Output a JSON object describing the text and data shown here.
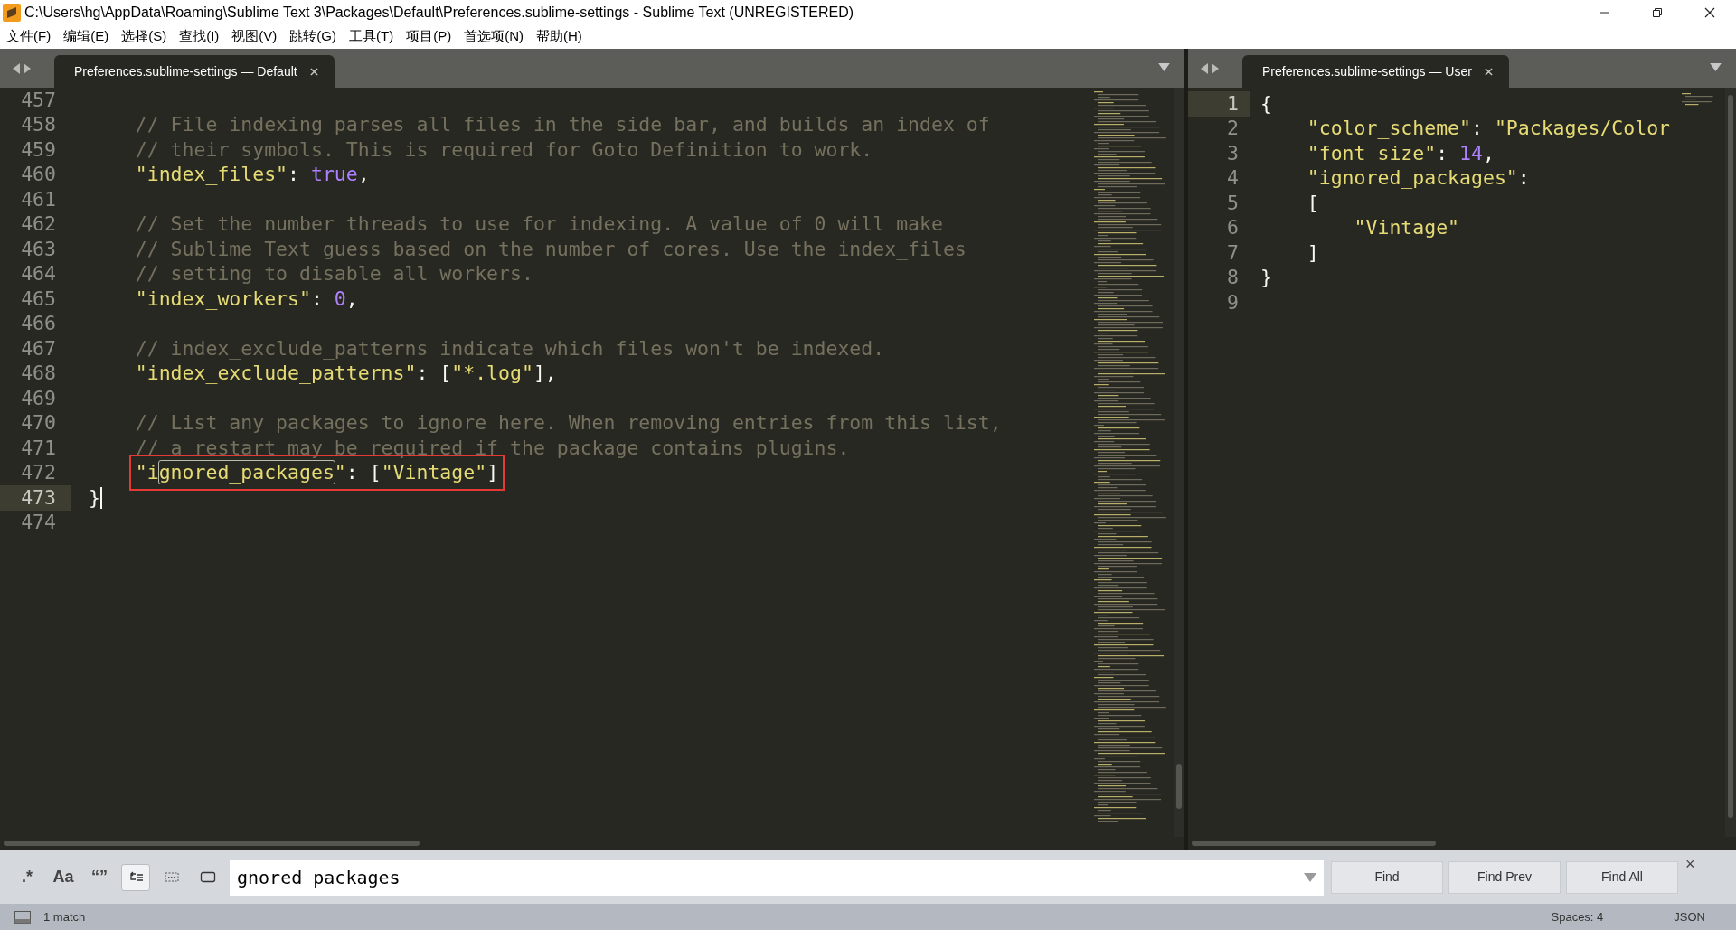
{
  "window": {
    "title": "C:\\Users\\hg\\AppData\\Roaming\\Sublime Text 3\\Packages\\Default\\Preferences.sublime-settings - Sublime Text (UNREGISTERED)"
  },
  "menu": [
    "文件(F)",
    "编辑(E)",
    "选择(S)",
    "查找(I)",
    "视图(V)",
    "跳转(G)",
    "工具(T)",
    "项目(P)",
    "首选项(N)",
    "帮助(H)"
  ],
  "panes": [
    {
      "tabs": [
        {
          "label": "Preferences.sublime-settings — Default",
          "selected": true
        }
      ],
      "lines": [
        {
          "number": "457",
          "current": false
        },
        {
          "number": "458",
          "current": false,
          "segments": [
            {
              "kind": "comment",
              "text": "    // File indexing parses all files in the side bar, and builds an index of"
            }
          ]
        },
        {
          "number": "459",
          "current": false,
          "segments": [
            {
              "kind": "comment",
              "text": "    // their symbols. This is required for Goto Definition to work."
            }
          ]
        },
        {
          "number": "460",
          "current": false,
          "segments": [
            {
              "kind": "string",
              "text": "    \"index_files\""
            },
            {
              "kind": "punct",
              "text": ": "
            },
            {
              "kind": "constant",
              "text": "true"
            },
            {
              "kind": "punct",
              "text": ","
            }
          ]
        },
        {
          "number": "461",
          "current": false
        },
        {
          "number": "462",
          "current": false,
          "segments": [
            {
              "kind": "comment",
              "text": "    // Set the number threads to use for indexing. A value of 0 will make"
            }
          ]
        },
        {
          "number": "463",
          "current": false,
          "segments": [
            {
              "kind": "comment",
              "text": "    // Sublime Text guess based on the number of cores. Use the index_files"
            }
          ]
        },
        {
          "number": "464",
          "current": false,
          "segments": [
            {
              "kind": "comment",
              "text": "    // setting to disable all workers."
            }
          ]
        },
        {
          "number": "465",
          "current": false,
          "segments": [
            {
              "kind": "string",
              "text": "    \"index_workers\""
            },
            {
              "kind": "punct",
              "text": ": "
            },
            {
              "kind": "constant",
              "text": "0"
            },
            {
              "kind": "punct",
              "text": ","
            }
          ]
        },
        {
          "number": "466",
          "current": false
        },
        {
          "number": "467",
          "current": false,
          "segments": [
            {
              "kind": "comment",
              "text": "    // index_exclude_patterns indicate which files won't be indexed."
            }
          ]
        },
        {
          "number": "468",
          "current": false,
          "segments": [
            {
              "kind": "string",
              "text": "    \"index_exclude_patterns\""
            },
            {
              "kind": "punct",
              "text": ": ["
            },
            {
              "kind": "string",
              "text": "\"*.log\""
            },
            {
              "kind": "punct",
              "text": "],"
            }
          ]
        },
        {
          "number": "469",
          "current": false
        },
        {
          "number": "470",
          "current": false,
          "segments": [
            {
              "kind": "comment",
              "text": "    // List any packages to ignore here. When removing entries from this list,"
            }
          ]
        },
        {
          "number": "471",
          "current": false,
          "segments": [
            {
              "kind": "comment",
              "text": "    // a restart may be required if the package contains plugins."
            }
          ]
        },
        {
          "number": "472",
          "current": false,
          "boxed": true,
          "segments": [
            {
              "kind": "string",
              "text": "\"i"
            },
            {
              "kind": "match",
              "text": "gnored_packages"
            },
            {
              "kind": "string",
              "text": "\""
            },
            {
              "kind": "punct",
              "text": ": ["
            },
            {
              "kind": "string",
              "text": "\"Vintage\""
            },
            {
              "kind": "punct",
              "text": "]"
            }
          ]
        },
        {
          "number": "473",
          "current": true,
          "cursor": true,
          "segments": [
            {
              "kind": "punct",
              "text": "}"
            }
          ]
        },
        {
          "number": "474",
          "current": false
        }
      ]
    },
    {
      "tabs": [
        {
          "label": "Preferences.sublime-settings — User",
          "selected": true
        }
      ],
      "lines": [
        {
          "number": "1",
          "current": true,
          "segments": [
            {
              "kind": "punct",
              "text": "{"
            }
          ]
        },
        {
          "number": "2",
          "current": false,
          "segments": [
            {
              "kind": "string",
              "text": "    \"color_scheme\""
            },
            {
              "kind": "punct",
              "text": ": "
            },
            {
              "kind": "string",
              "text": "\"Packages/Color"
            }
          ]
        },
        {
          "number": "3",
          "current": false,
          "segments": [
            {
              "kind": "string",
              "text": "    \"font_size\""
            },
            {
              "kind": "punct",
              "text": ": "
            },
            {
              "kind": "constant",
              "text": "14"
            },
            {
              "kind": "punct",
              "text": ","
            }
          ]
        },
        {
          "number": "4",
          "current": false,
          "segments": [
            {
              "kind": "string",
              "text": "    \"ignored_packages\""
            },
            {
              "kind": "punct",
              "text": ":"
            }
          ]
        },
        {
          "number": "5",
          "current": false,
          "segments": [
            {
              "kind": "punct",
              "text": "    ["
            }
          ]
        },
        {
          "number": "6",
          "current": false,
          "segments": [
            {
              "kind": "string",
              "text": "        \"Vintage\""
            }
          ]
        },
        {
          "number": "7",
          "current": false,
          "segments": [
            {
              "kind": "punct",
              "text": "    ]"
            }
          ]
        },
        {
          "number": "8",
          "current": false,
          "segments": [
            {
              "kind": "punct",
              "text": "}"
            }
          ]
        },
        {
          "number": "9",
          "current": false
        }
      ]
    }
  ],
  "find_panel": {
    "toggles": [
      {
        "kind": "regex",
        "label": ".*",
        "on": false
      },
      {
        "kind": "case",
        "label": "Aa",
        "on": false
      },
      {
        "kind": "word",
        "label": "“”",
        "on": false
      },
      {
        "kind": "wrap",
        "on": true
      },
      {
        "kind": "selection",
        "on": false
      },
      {
        "kind": "highlight",
        "on": false
      }
    ],
    "value": "gnored_packages",
    "buttons": [
      "Find",
      "Find Prev",
      "Find All"
    ],
    "close": "×"
  },
  "status_bar": {
    "left": "1 match",
    "indentation": "Spaces: 4",
    "syntax": "JSON"
  }
}
